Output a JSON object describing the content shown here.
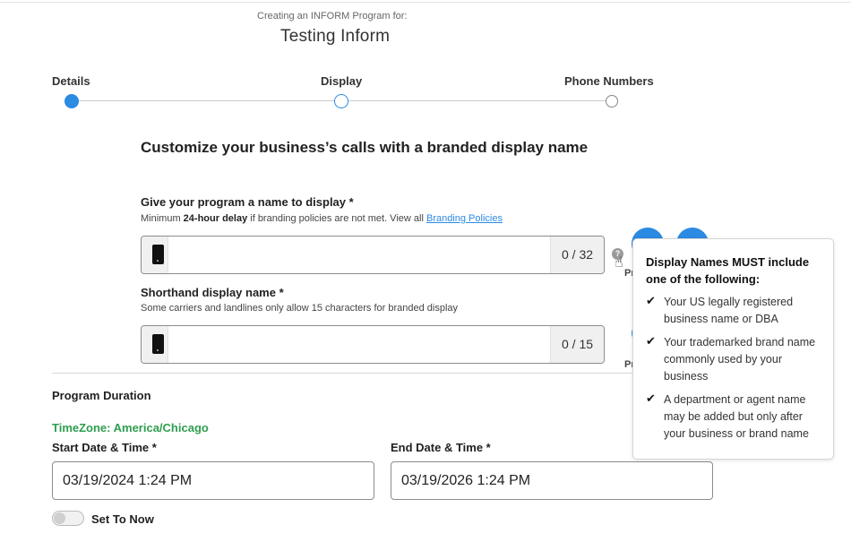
{
  "header": {
    "subtitle": "Creating an INFORM Program for:",
    "title": "Testing Inform"
  },
  "stepper": {
    "steps": [
      {
        "label": "Details",
        "state": "complete"
      },
      {
        "label": "Display",
        "state": "current"
      },
      {
        "label": "Phone Numbers",
        "state": "upcoming"
      }
    ]
  },
  "form": {
    "heading": "Customize your business’s calls with a branded display name",
    "display_name": {
      "label": "Give your program a name to display *",
      "help_prefix": "Minimum ",
      "help_bold": "24-hour delay",
      "help_suffix": " if branding policies are not met. View all ",
      "help_link": "Branding Policies",
      "value": "",
      "counter": "0 / 32"
    },
    "shorthand": {
      "label": "Shorthand display name *",
      "help": "Some carriers and landlines only allow 15 characters for branded display",
      "value": "",
      "counter": "0 / 15"
    },
    "help_icon_glyph": "?",
    "peek_labels": [
      "Pr",
      "Pr"
    ]
  },
  "duration": {
    "label": "Program Duration",
    "timezone": "TimeZone: America/Chicago",
    "start_label": "Start Date & Time *",
    "start_value": "03/19/2024 1:24 PM",
    "end_label": "End Date & Time *",
    "end_value": "03/19/2026 1:24 PM",
    "set_to_now_label": "Set To Now",
    "set_to_now_on": false
  },
  "tooltip": {
    "title": "Display Names MUST include one of the following:",
    "items": [
      "Your US legally registered business name or DBA",
      "Your trademarked brand name commonly used by your business",
      "A department or agent name may be added but only after your business or brand name"
    ]
  },
  "colors": {
    "accent": "#2b8ae2",
    "timezone": "#2e9e4f"
  }
}
